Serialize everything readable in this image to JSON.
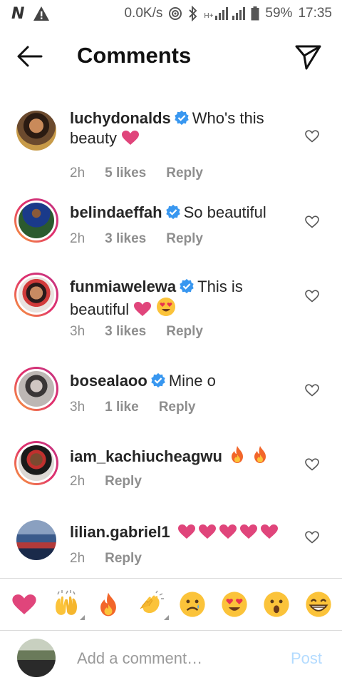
{
  "status_bar": {
    "speed": "0.0K/s",
    "network": "H+",
    "battery": "59%",
    "time": "17:35"
  },
  "header": {
    "title": "Comments"
  },
  "comments": [
    {
      "username": "luchydonalds",
      "verified": true,
      "text": "Who's this beauty",
      "emojis": [
        "pink-heart"
      ],
      "time": "2h",
      "likes": "5 likes",
      "reply": "Reply",
      "avatar_ring": false
    },
    {
      "username": "belindaeffah",
      "verified": true,
      "text": "So beautiful",
      "emojis": [],
      "time": "2h",
      "likes": "3 likes",
      "reply": "Reply",
      "avatar_ring": true
    },
    {
      "username": "funmiawelewa",
      "verified": true,
      "text": "This is beautiful",
      "emojis": [
        "pink-heart",
        "heart-eyes"
      ],
      "time": "3h",
      "likes": "3 likes",
      "reply": "Reply",
      "avatar_ring": true
    },
    {
      "username": "bosealaoo",
      "verified": true,
      "text": "Mine o",
      "emojis": [],
      "time": "3h",
      "likes": "1 like",
      "reply": "Reply",
      "avatar_ring": true
    },
    {
      "username": "iam_kachiucheagwu",
      "verified": false,
      "text": "",
      "emojis": [
        "fire",
        "fire"
      ],
      "time": "2h",
      "likes": "",
      "reply": "Reply",
      "avatar_ring": true
    },
    {
      "username": "lilian.gabriel1",
      "verified": false,
      "text": "",
      "emojis": [
        "pink-heart",
        "pink-heart",
        "pink-heart",
        "pink-heart",
        "pink-heart"
      ],
      "time": "2h",
      "likes": "",
      "reply": "Reply",
      "avatar_ring": false
    }
  ],
  "emoji_bar": [
    "pink-heart",
    "raising-hands",
    "fire",
    "clapping-hands",
    "sad-face",
    "heart-eyes",
    "surprised-face",
    "grinning-face"
  ],
  "add_comment": {
    "placeholder": "Add a comment…",
    "post_label": "Post"
  },
  "colors": {
    "verified_blue": "#3897f0",
    "post_disabled": "#b3dbff",
    "pink_heart": "#e0457b",
    "meta_gray": "#8e8e8e"
  }
}
